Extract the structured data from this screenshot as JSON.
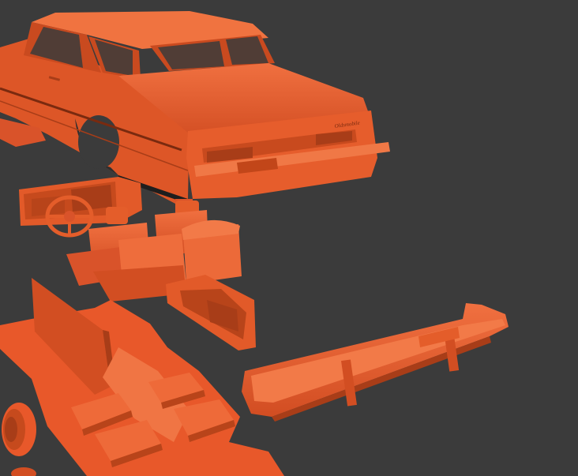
{
  "scene": {
    "background_color": "#3b3b3b",
    "model_color": "#e8582a",
    "model_shadow_color": "#b63c17",
    "model_highlight_color": "#f2733f",
    "emblem_text": "Oldsmobile"
  },
  "parts": [
    {
      "name": "car-body"
    },
    {
      "name": "dashboard"
    },
    {
      "name": "steering-wheel"
    },
    {
      "name": "front-seats"
    },
    {
      "name": "rear-seat"
    },
    {
      "name": "door-panel"
    },
    {
      "name": "floor-pan"
    },
    {
      "name": "rear-bumper"
    },
    {
      "name": "wheel"
    }
  ]
}
